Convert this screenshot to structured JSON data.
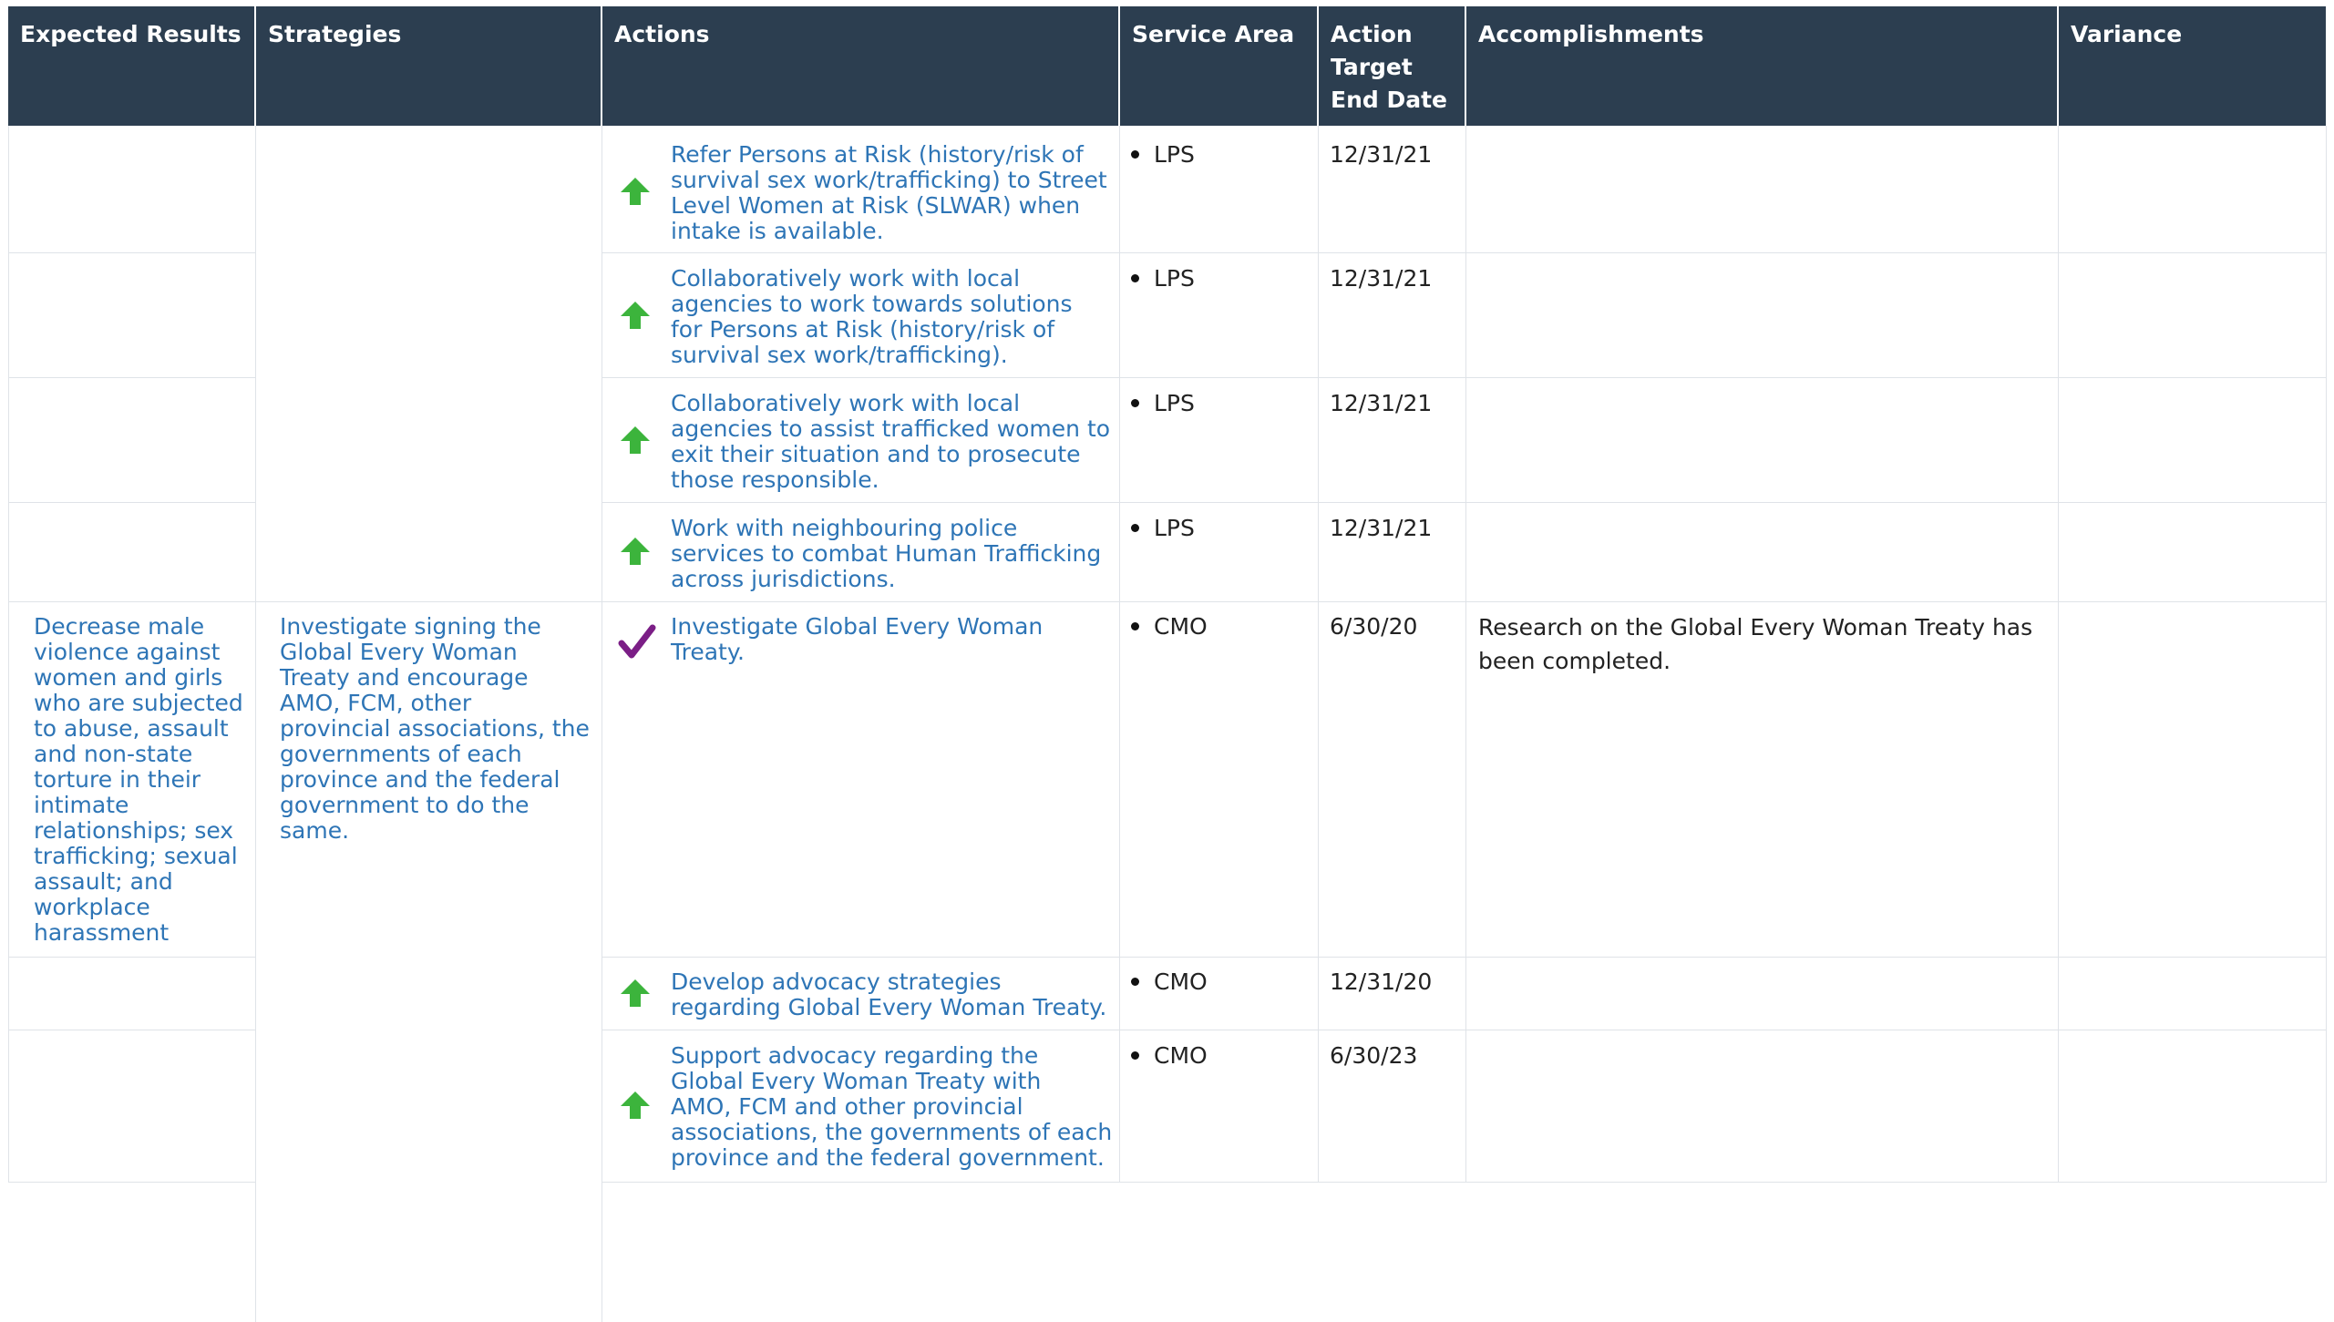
{
  "colors": {
    "header_bg": "#2c3e50",
    "link": "#2e75b6",
    "up_arrow": "#3cb43c",
    "check": "#7b1e86"
  },
  "headers": {
    "expected_results": "Expected Results",
    "strategies": "Strategies",
    "actions": "Actions",
    "service_area": "Service Area",
    "target_date_l1": "Action",
    "target_date_l2": "Target",
    "target_date_l3": "End Date",
    "accomplishments": "Accomplishments",
    "variance": "Variance"
  },
  "expected_result": {
    "lines": [
      "Decrease male",
      "violence against",
      "women and girls",
      "who are subjected",
      "to abuse, assault",
      "and non-state",
      "torture in their",
      "intimate",
      "relationships; sex",
      "trafficking; sexual",
      "assault; and",
      "workplace",
      "harassment"
    ]
  },
  "strategy": {
    "lines": [
      "Investigate signing the",
      "Global Every Woman",
      "Treaty and encourage",
      "AMO, FCM, other",
      "provincial associations, the",
      "governments of each",
      "province and the federal",
      "government to do the",
      "same."
    ]
  },
  "rows": [
    {
      "status_icon": "up-arrow-icon",
      "action_lines": [
        "Refer Persons at Risk (history/risk of",
        "survival sex work/trafficking) to Street",
        "Level Women at Risk (SLWAR) when",
        "intake is available."
      ],
      "service_area": "LPS",
      "target_date": "12/31/21",
      "accomplishment_lines": [],
      "variance": ""
    },
    {
      "status_icon": "up-arrow-icon",
      "action_lines": [
        "Collaboratively work with local",
        "agencies to work towards solutions",
        "for Persons at Risk (history/risk of",
        "survival sex work/trafficking)."
      ],
      "service_area": "LPS",
      "target_date": "12/31/21",
      "accomplishment_lines": [],
      "variance": ""
    },
    {
      "status_icon": "up-arrow-icon",
      "action_lines": [
        "Collaboratively work with local",
        "agencies to assist trafficked women to",
        "exit their situation and to prosecute",
        "those responsible."
      ],
      "service_area": "LPS",
      "target_date": "12/31/21",
      "accomplishment_lines": [],
      "variance": ""
    },
    {
      "status_icon": "up-arrow-icon",
      "action_lines": [
        "Work with neighbouring police",
        "services to combat Human Trafficking",
        "across jurisdictions."
      ],
      "service_area": "LPS",
      "target_date": "12/31/21",
      "accomplishment_lines": [],
      "variance": ""
    },
    {
      "status_icon": "checkmark-icon",
      "action_lines": [
        "Investigate Global Every Woman",
        "Treaty."
      ],
      "service_area": "CMO",
      "target_date": "6/30/20",
      "accomplishment_lines": [
        "Research on the Global Every Woman Treaty has",
        "been completed."
      ],
      "variance": ""
    },
    {
      "status_icon": "up-arrow-icon",
      "action_lines": [
        "Develop advocacy strategies",
        "regarding Global Every Woman Treaty."
      ],
      "service_area": "CMO",
      "target_date": "12/31/20",
      "accomplishment_lines": [],
      "variance": ""
    },
    {
      "status_icon": "up-arrow-icon",
      "action_lines": [
        "Support advocacy regarding the",
        "Global Every Woman Treaty with",
        "AMO, FCM and other provincial",
        "associations, the governments of each",
        "province and the federal government."
      ],
      "service_area": "CMO",
      "target_date": "6/30/23",
      "accomplishment_lines": [],
      "variance": ""
    }
  ]
}
